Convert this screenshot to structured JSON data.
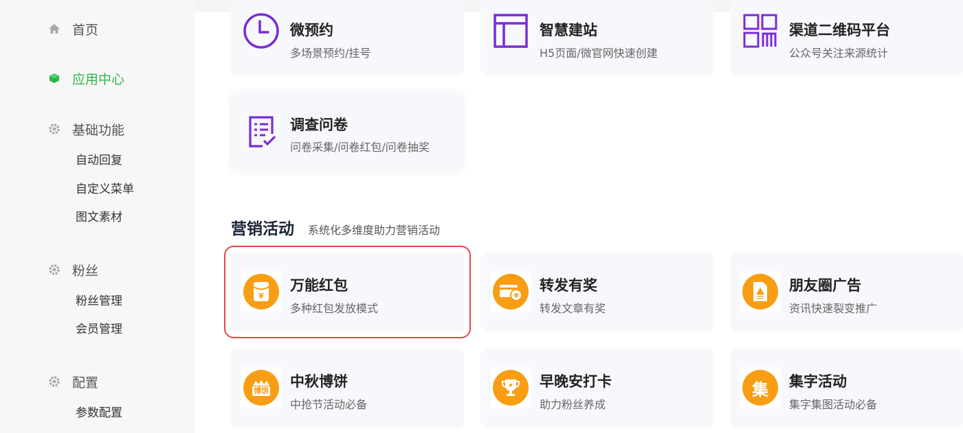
{
  "sidebar": {
    "home": "首页",
    "app_center": "应用中心",
    "basic": "基础功能",
    "basic_items": [
      "自动回复",
      "自定义菜单",
      "图文素材"
    ],
    "fans": "粉丝",
    "fans_items": [
      "粉丝管理",
      "会员管理"
    ],
    "config": "配置",
    "config_items": [
      "参数配置"
    ]
  },
  "tools": [
    {
      "title": "微预约",
      "desc": "多场景预约/挂号",
      "icon": "clock-icon"
    },
    {
      "title": "智慧建站",
      "desc": "H5页面/微官网快速创建",
      "icon": "layout-icon"
    },
    {
      "title": "渠道二维码平台",
      "desc": "公众号关注来源统计",
      "icon": "qrcode-icon"
    },
    {
      "title": "调查问卷",
      "desc": "问卷采集/问卷红包/问卷抽奖",
      "icon": "survey-icon"
    }
  ],
  "marketing": {
    "title": "营销活动",
    "subtitle": "系统化多维度助力营销活动",
    "items": [
      {
        "title": "万能红包",
        "desc": "多种红包发放模式",
        "icon": "red-packet-icon"
      },
      {
        "title": "转发有奖",
        "desc": "转发文章有奖",
        "icon": "share-reward-icon"
      },
      {
        "title": "朋友圈广告",
        "desc": "资讯快速裂变推广",
        "icon": "moments-ad-icon"
      },
      {
        "title": "中秋博饼",
        "desc": "中抢节活动必备",
        "icon": "mooncake-icon",
        "badge": "博饼"
      },
      {
        "title": "早晚安打卡",
        "desc": "助力粉丝养成",
        "icon": "trophy-icon"
      },
      {
        "title": "集字活动",
        "desc": "集字集图活动必备",
        "icon": "collect-words-icon",
        "badge": "集"
      }
    ]
  },
  "colors": {
    "accent_green": "#2db84d",
    "purple": "#7a2bd8",
    "orange": "#f89d14",
    "selection": "#e64545"
  }
}
